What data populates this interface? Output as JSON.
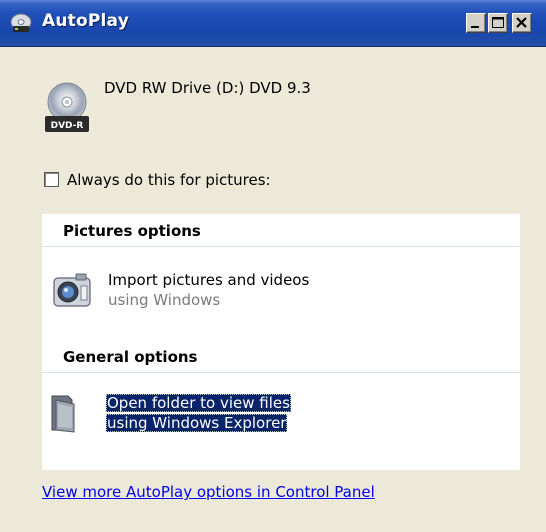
{
  "window": {
    "title": "AutoPlay",
    "icon": "autoplay-icon",
    "controls": {
      "minimize": "minimize-icon",
      "maximize": "maximize-icon",
      "close": "close-icon"
    }
  },
  "device": {
    "title": "DVD RW Drive (D:) DVD 9.3",
    "icon": "dvd-r-icon",
    "icon_label": "DVD-R"
  },
  "always_checkbox": {
    "label": "Always do this for pictures:",
    "checked": false
  },
  "sections": [
    {
      "header": "Pictures options",
      "options": [
        {
          "line1": "Import pictures and videos",
          "line2": "using Windows",
          "icon": "camera-icon"
        }
      ]
    },
    {
      "header": "General options",
      "options": [
        {
          "line1": "Open folder to view files",
          "line2": "using Windows Explorer",
          "icon": "folder-icon",
          "selected": true
        }
      ]
    }
  ],
  "footer_link": "View more AutoPlay options in Control Panel",
  "colors": {
    "title_bar": "#1f4fb9",
    "selection": "#0a246a",
    "link": "#0000ee",
    "window_bg": "#ece9d8"
  }
}
